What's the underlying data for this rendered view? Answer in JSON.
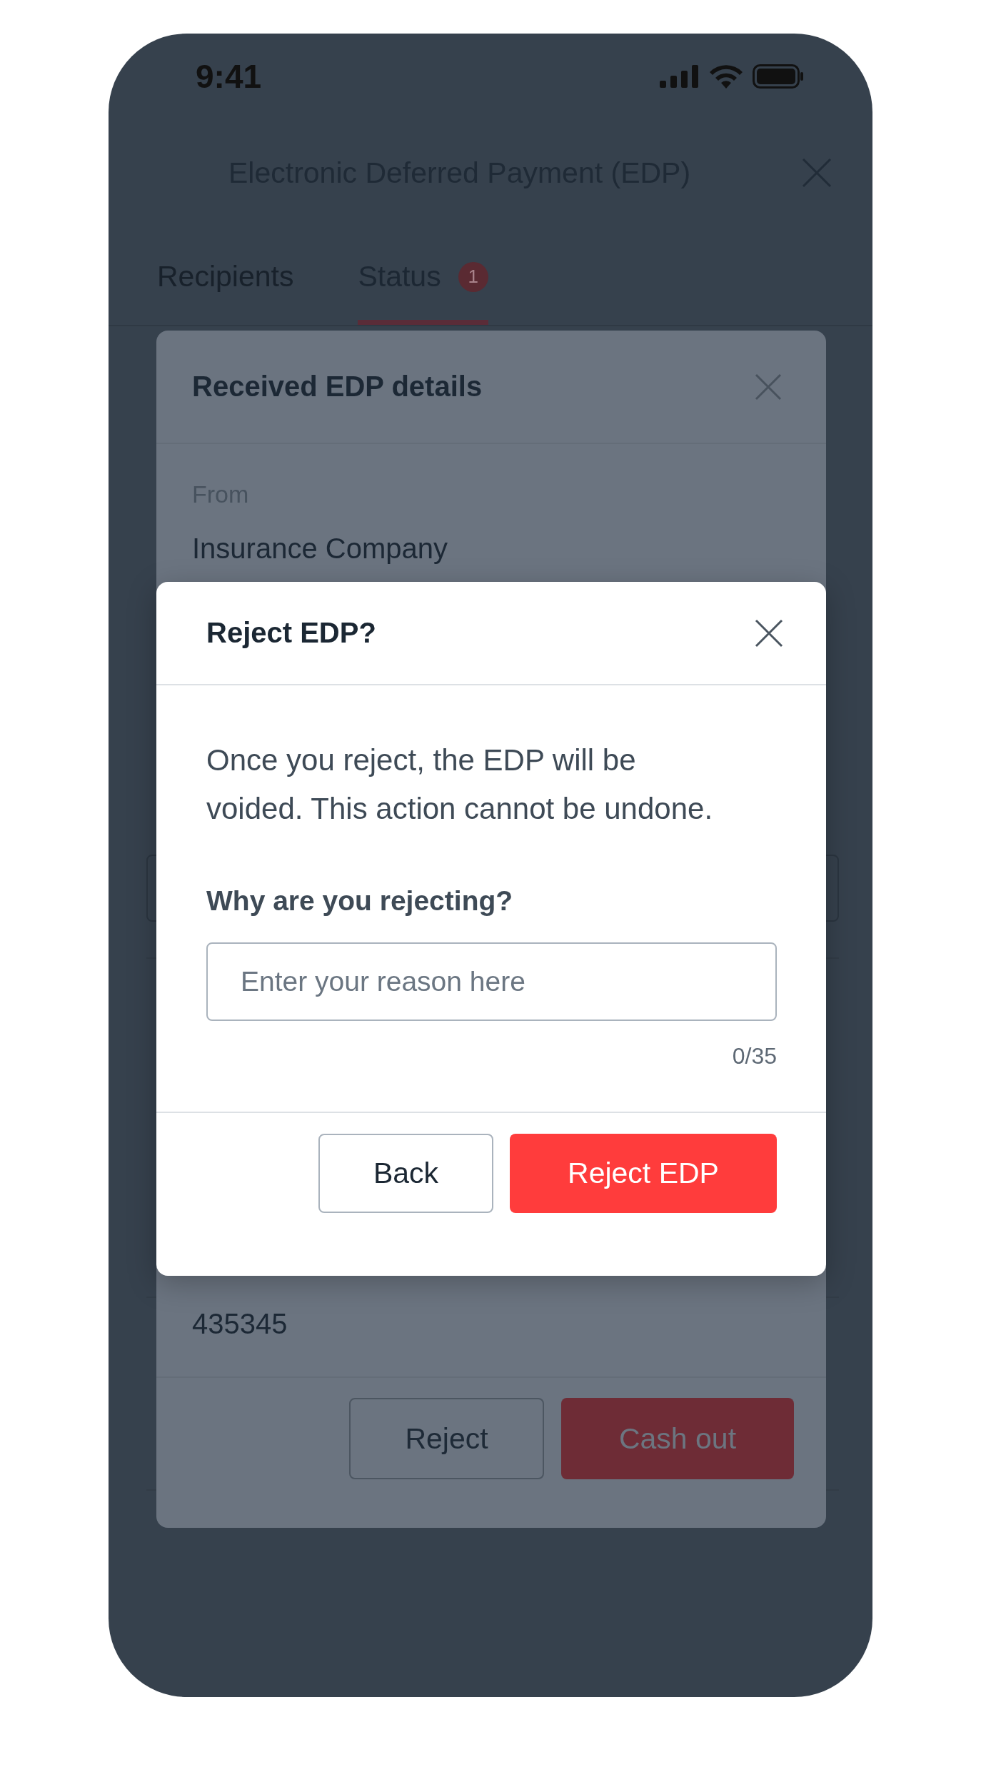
{
  "status_bar": {
    "time": "9:41"
  },
  "header": {
    "title": "Electronic Deferred Payment (EDP)"
  },
  "tabs": [
    {
      "label": "Recipients",
      "selected": false
    },
    {
      "label": "Status",
      "selected": true,
      "badge": "1"
    }
  ],
  "page_behind": [
    {
      "kind": "field"
    },
    {
      "kind": "divider"
    },
    {
      "kind": "divider"
    },
    {
      "kind": "divider"
    }
  ],
  "details_panel": {
    "title": "Received EDP details",
    "from_label": "From",
    "from_value": "Insurance Company",
    "reference_value": "435345",
    "buttons": [
      {
        "label": "Reject",
        "kind": "secondary"
      },
      {
        "label": "Cash out",
        "kind": "primary"
      }
    ]
  },
  "dialog": {
    "title": "Reject EDP?",
    "message": "Once you reject, the EDP will be voided. This action cannot be undone.",
    "question": "Why are you rejecting?",
    "reason_field": {
      "placeholder": "Enter your reason here"
    },
    "counter": "0/35",
    "buttons": [
      {
        "label": "Back",
        "kind": "secondary"
      },
      {
        "label": "Reject EDP",
        "kind": "danger"
      }
    ]
  }
}
